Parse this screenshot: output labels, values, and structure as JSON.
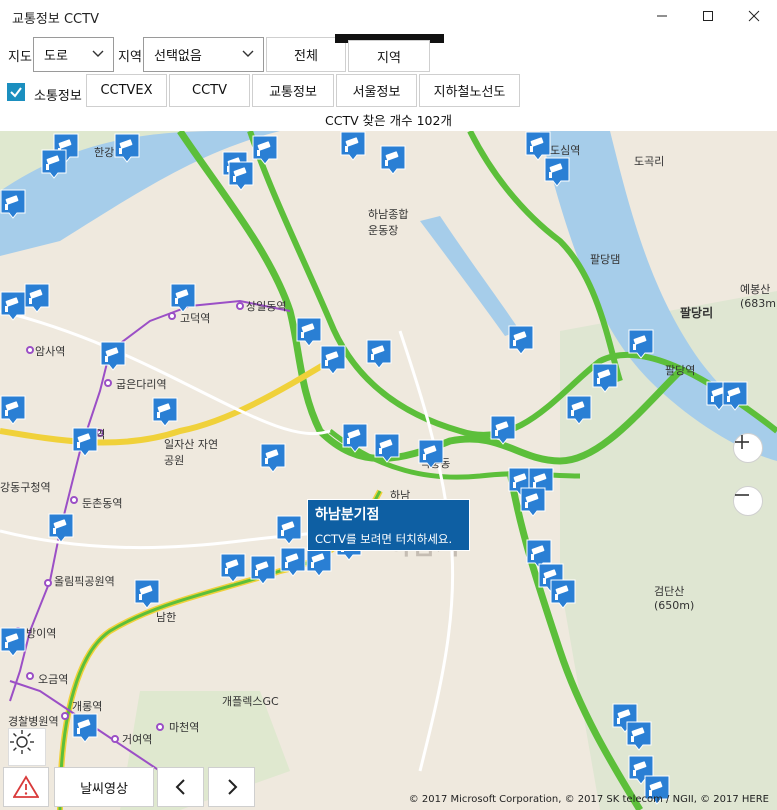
{
  "window": {
    "title": "교통정보 CCTV",
    "minimize": "—",
    "maximize": "☐",
    "close": "✕"
  },
  "toolbar": {
    "map_label": "지도",
    "map_select": "도로",
    "region_label": "지역",
    "region_select": "선택없음",
    "all_button": "전체",
    "region_button": "지역",
    "traffic_check_label": "소통정보",
    "buttons": [
      "CCTVEX",
      "CCTV",
      "교통정보",
      "서울정보",
      "지하철노선도"
    ]
  },
  "count_text": "CCTV 찾은 개수  102개",
  "callout": {
    "title": "하남분기점",
    "subtitle": "CCTV를 보려면 터치하세요."
  },
  "map_labels": [
    "암사역",
    "굽은다리역",
    "길동역",
    "둔촌동역",
    "올림픽공원역",
    "방이역",
    "오금역",
    "개롱역",
    "거여역",
    "마천역",
    "상일동역",
    "고덕역",
    "도심역",
    "도곡리",
    "팔당역",
    "팔당리",
    "하남",
    "하남시",
    "남한",
    "개플렉스GC",
    "강동구청역",
    "일자산 자연공원",
    "검단산 (650m)",
    "예봉산 (683m)",
    "한강",
    "하남종합 운동장",
    "올림픽공원역",
    "팔당댐",
    "경찰병원역",
    "덕풍동"
  ],
  "weather_button": "날씨영상",
  "prev_icon": "chevron-left-icon",
  "next_icon": "chevron-right-icon",
  "copyright": "© 2017 Microsoft Corporation, © 2017 SK telecom / NGII, © 2017 HERE",
  "colors": {
    "accent": "#1b8fbf",
    "callout": "#0e5fa3",
    "camera": "#2a7fd4",
    "road_green": "#5cbf3a",
    "river": "#9cc8e8"
  }
}
